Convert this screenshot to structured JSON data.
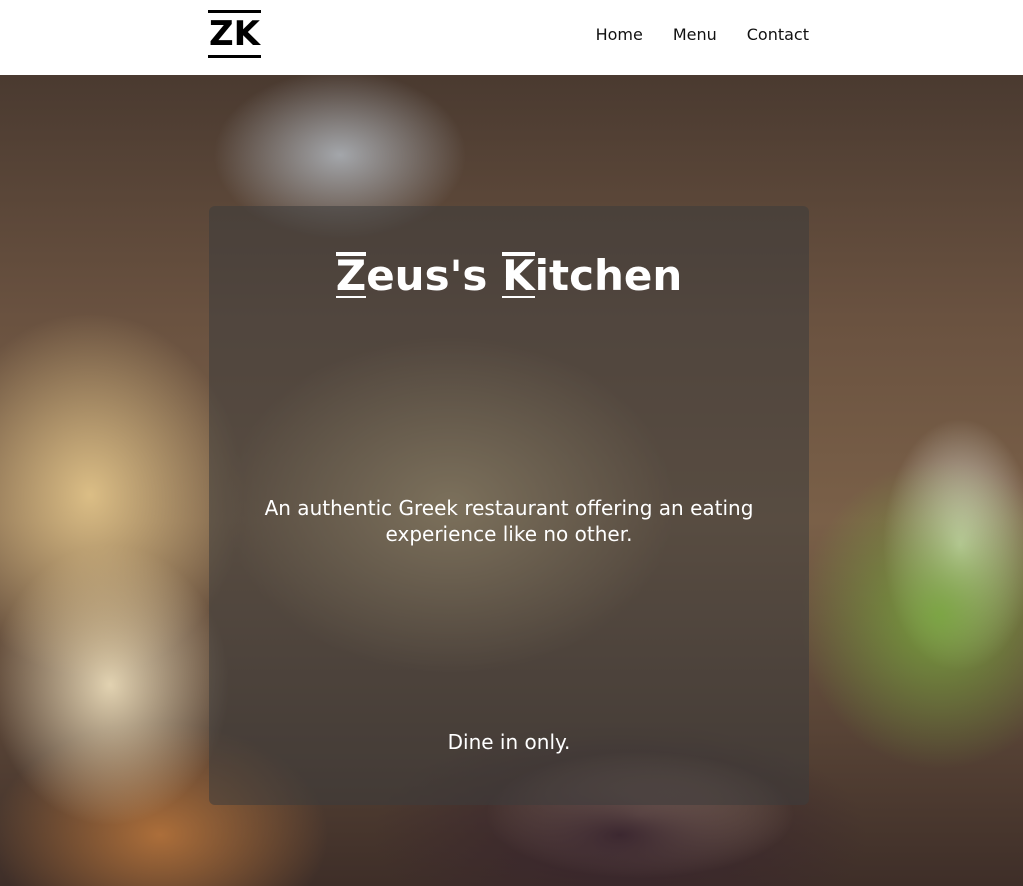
{
  "header": {
    "logo_text": "ZK",
    "nav": [
      {
        "label": "Home"
      },
      {
        "label": "Menu"
      },
      {
        "label": "Contact"
      }
    ]
  },
  "hero": {
    "title_initial_1": "Z",
    "title_rest_1": "eus's ",
    "title_initial_2": "K",
    "title_rest_2": "itchen",
    "tagline": "An authentic Greek restaurant offering an eating experience like no other.",
    "note": "Dine in only."
  }
}
